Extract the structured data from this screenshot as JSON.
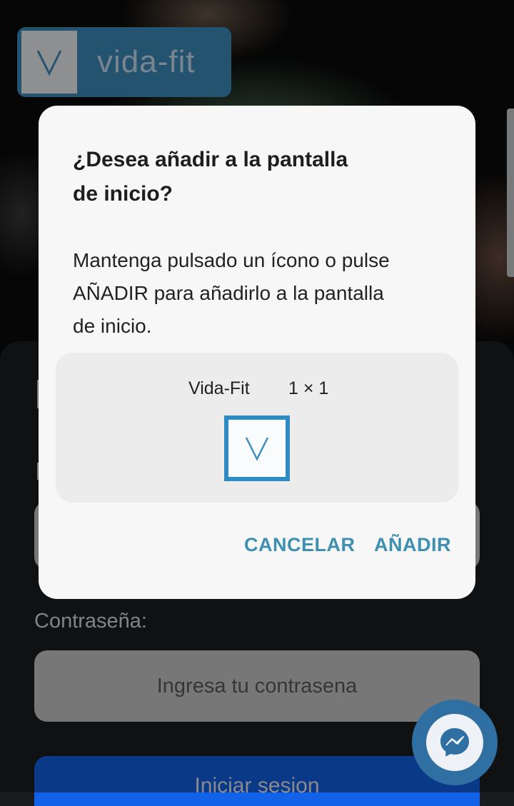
{
  "brand": {
    "name": "vida-fit",
    "accent": "#3f8fc0"
  },
  "form": {
    "password_label": "Contraseña:",
    "password_placeholder": "Ingresa tu contrasena",
    "login_button": "Iniciar sesion"
  },
  "dialog": {
    "title": "¿Desea añadir a la pantalla de inicio?",
    "body": "Mantenga pulsado un ícono o pulse AÑADIR para añadirlo a la pantalla de inicio.",
    "widget_name": "Vida-Fit",
    "widget_size": "1 × 1",
    "cancel_label": "CANCELAR",
    "add_label": "AÑADIR",
    "button_color": "#3f8fb0"
  },
  "messenger": {
    "icon": "messenger-icon"
  }
}
